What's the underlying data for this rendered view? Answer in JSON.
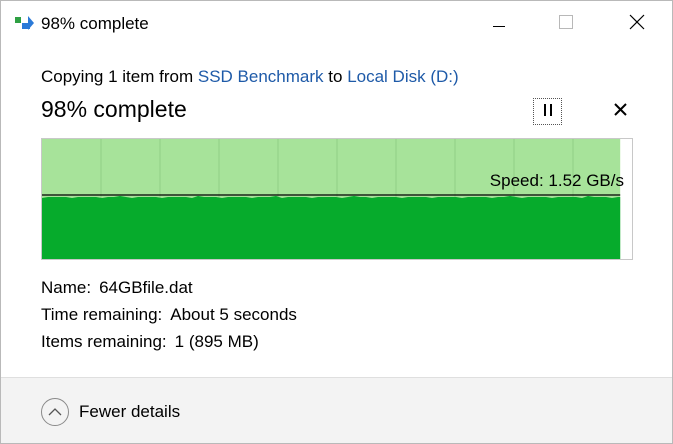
{
  "window": {
    "title": "98% complete"
  },
  "copy": {
    "prefix": "Copying 1 item from",
    "source": "SSD Benchmark",
    "middle": "to",
    "destination": "Local Disk (D:)"
  },
  "progress": {
    "label": "98% complete",
    "fraction": 0.98
  },
  "graph": {
    "speed_text": "Speed: 1.52 GB/s",
    "colors": {
      "remaining_fill": "#a7e39a",
      "transferred_fill": "#06ab2c",
      "grid_line": "#90cf85",
      "speed_line": "#000000"
    }
  },
  "details": {
    "name_label": "Name:",
    "name_value": "64GBfile.dat",
    "time_label": "Time remaining:",
    "time_value": "About 5 seconds",
    "items_label": "Items remaining:",
    "items_value": "1 (895 MB)"
  },
  "footer": {
    "toggle_label": "Fewer details"
  },
  "icons": {
    "app": "copy-progress-icon",
    "minimize": "minimize-icon",
    "maximize": "maximize-icon",
    "close": "close-icon",
    "pause": "pause-icon",
    "cancel": "cancel-icon",
    "collapse": "chevron-up-icon"
  }
}
